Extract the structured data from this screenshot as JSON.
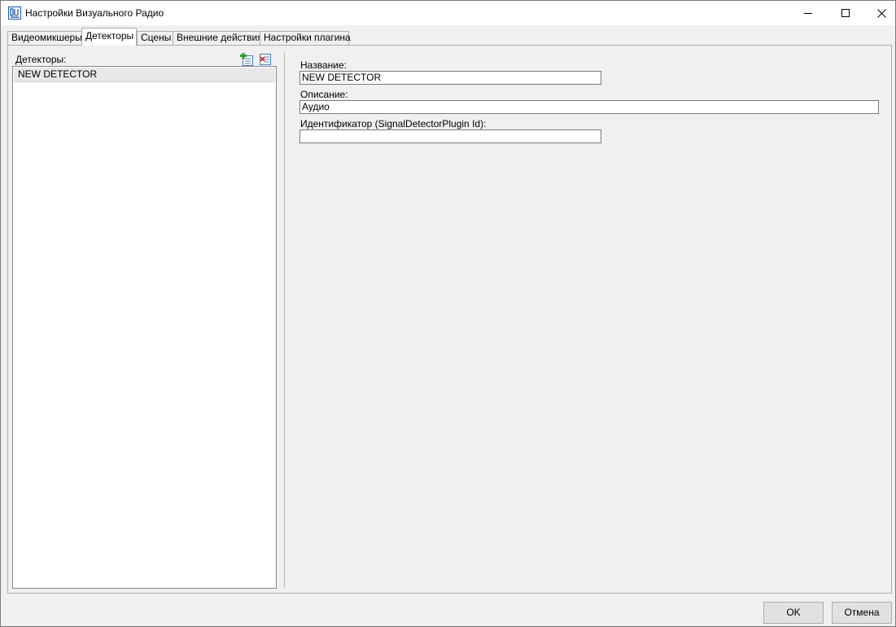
{
  "window": {
    "title": "Настройки Визуального Радио",
    "app_icon": "app-logo-icon",
    "controls": [
      "minimize-icon",
      "maximize-icon",
      "close-icon"
    ]
  },
  "tabs": [
    {
      "label": "Видеомикшеры",
      "active": false
    },
    {
      "label": "Детекторы",
      "active": true
    },
    {
      "label": "Сцены",
      "active": false
    },
    {
      "label": "Внешние действия",
      "active": false
    },
    {
      "label": "Настройки плагина",
      "active": false
    }
  ],
  "detectors": {
    "label": "Детекторы:",
    "add_icon": "add-item-icon",
    "delete_icon": "delete-item-icon",
    "items": [
      "NEW DETECTOR"
    ],
    "selected_index": 0
  },
  "details": {
    "name_label": "Название:",
    "name_value": "NEW DETECTOR",
    "description_label": "Описание:",
    "description_value": "Аудио",
    "id_label": "Идентификатор (SignalDetectorPlugin Id):",
    "id_value": ""
  },
  "buttons": {
    "ok": "OK",
    "cancel": "Отмена"
  }
}
